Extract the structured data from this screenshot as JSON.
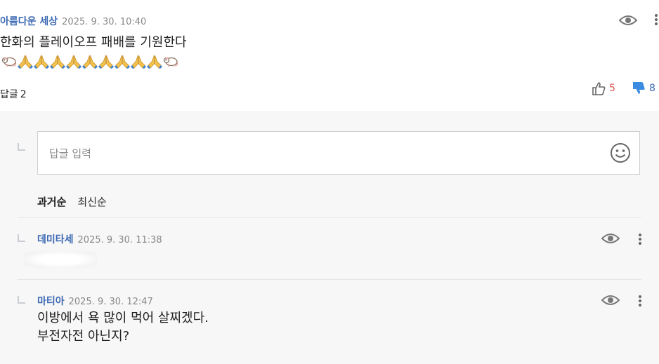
{
  "comment": {
    "author": "아름다운 세상",
    "timestamp": "2025. 9. 30. 10:40",
    "text": "한화의 플레이오프 패배를 기원한다",
    "emojis": [
      "rat",
      "pray",
      "pray",
      "pray",
      "pray",
      "pray",
      "pray",
      "pray",
      "pray",
      "pray",
      "rat"
    ],
    "reply_label": "답글",
    "reply_count": "2",
    "likes": "5",
    "dislikes": "8",
    "icons": {
      "view": "eye-icon",
      "like": "thumbs-up-icon",
      "dislike": "thumbs-down-icon"
    },
    "colors": {
      "author": "#3b68b3",
      "like": "#d9534f",
      "dislike": "#3b68b3"
    }
  },
  "reply_section": {
    "input_placeholder": "답글 입력",
    "sort_options": [
      "과거순",
      "최신순"
    ],
    "selected_sort": "과거순",
    "replies": [
      {
        "author": "데미타세",
        "timestamp": "2025. 9. 30. 11:38",
        "text": ""
      },
      {
        "author": "마티아",
        "timestamp": "2025. 9. 30. 12:47",
        "lines": [
          "이방에서 욕 많이 먹어 살찌겠다.",
          "부전자전 아닌지?"
        ]
      }
    ]
  }
}
